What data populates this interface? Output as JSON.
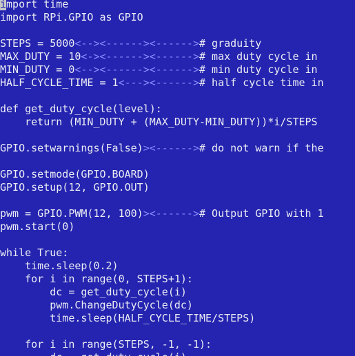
{
  "colors": {
    "background": "#2424b0",
    "text": "#ececf4",
    "tab_marker": "#8a8aff",
    "cursor": "#c8c8c8"
  },
  "editor": {
    "cursor": {
      "line": 0,
      "char": "i"
    },
    "lines": [
      {
        "row": 0,
        "segments": [
          {
            "text": "i",
            "kind": "cursor"
          },
          {
            "text": "mport time",
            "kind": "code"
          }
        ]
      },
      {
        "row": 1,
        "segments": [
          {
            "text": "import RPi.GPIO as GPIO",
            "kind": "code"
          }
        ]
      },
      {
        "row": 3,
        "segments": [
          {
            "text": "STEPS = 5000",
            "kind": "code"
          },
          {
            "text": "<--><------><------>",
            "kind": "tab"
          },
          {
            "text": "# graduity",
            "kind": "code"
          }
        ]
      },
      {
        "row": 4,
        "segments": [
          {
            "text": "MAX_DUTY = 10",
            "kind": "code"
          },
          {
            "text": "<-><------><------>",
            "kind": "tab"
          },
          {
            "text": "# max duty cycle in",
            "kind": "code"
          }
        ]
      },
      {
        "row": 5,
        "segments": [
          {
            "text": "MIN_DUTY = 0",
            "kind": "code"
          },
          {
            "text": "<--><------><------>",
            "kind": "tab"
          },
          {
            "text": "# min duty cycle in",
            "kind": "code"
          }
        ]
      },
      {
        "row": 6,
        "segments": [
          {
            "text": "HALF_CYCLE_TIME = 1",
            "kind": "code"
          },
          {
            "text": "<---><------>",
            "kind": "tab"
          },
          {
            "text": "# half cycle time in",
            "kind": "code"
          }
        ]
      },
      {
        "row": 8,
        "segments": [
          {
            "text": "def get_duty_cycle(level):",
            "kind": "code"
          }
        ]
      },
      {
        "row": 9,
        "segments": [
          {
            "text": "    return (MIN_DUTY + (MAX_DUTY-MIN_DUTY))*i/STEPS",
            "kind": "code"
          }
        ]
      },
      {
        "row": 11,
        "segments": [
          {
            "text": "GPIO.setwarnings(False)",
            "kind": "code"
          },
          {
            "text": "><------>",
            "kind": "tab"
          },
          {
            "text": "# do not warn if the",
            "kind": "code"
          }
        ]
      },
      {
        "row": 13,
        "segments": [
          {
            "text": "GPIO.setmode(GPIO.BOARD)",
            "kind": "code"
          }
        ]
      },
      {
        "row": 14,
        "segments": [
          {
            "text": "GPIO.setup(12, GPIO.OUT)",
            "kind": "code"
          }
        ]
      },
      {
        "row": 16,
        "segments": [
          {
            "text": "pwm = GPIO.PWM(12, 100)",
            "kind": "code"
          },
          {
            "text": "><------>",
            "kind": "tab"
          },
          {
            "text": "# Output GPIO with 1",
            "kind": "code"
          }
        ]
      },
      {
        "row": 17,
        "segments": [
          {
            "text": "pwm.start(0)",
            "kind": "code"
          }
        ]
      },
      {
        "row": 19,
        "segments": [
          {
            "text": "while True:",
            "kind": "code"
          }
        ]
      },
      {
        "row": 20,
        "segments": [
          {
            "text": "    time.sleep(0.2)",
            "kind": "code"
          }
        ]
      },
      {
        "row": 21,
        "segments": [
          {
            "text": "    for i in range(0, STEPS+1):",
            "kind": "code"
          }
        ]
      },
      {
        "row": 22,
        "segments": [
          {
            "text": "        dc = get_duty_cycle(i)",
            "kind": "code"
          }
        ]
      },
      {
        "row": 23,
        "segments": [
          {
            "text": "        pwm.ChangeDutyCycle(dc)",
            "kind": "code"
          }
        ]
      },
      {
        "row": 24,
        "segments": [
          {
            "text": "        time.sleep(HALF_CYCLE_TIME/STEPS)",
            "kind": "code"
          }
        ]
      },
      {
        "row": 26,
        "segments": [
          {
            "text": "    for i in range(STEPS, -1, -1):",
            "kind": "code"
          }
        ]
      },
      {
        "row": 27,
        "segments": [
          {
            "text": "        dc = get_duty_cycle(i)",
            "kind": "code"
          }
        ]
      }
    ]
  }
}
